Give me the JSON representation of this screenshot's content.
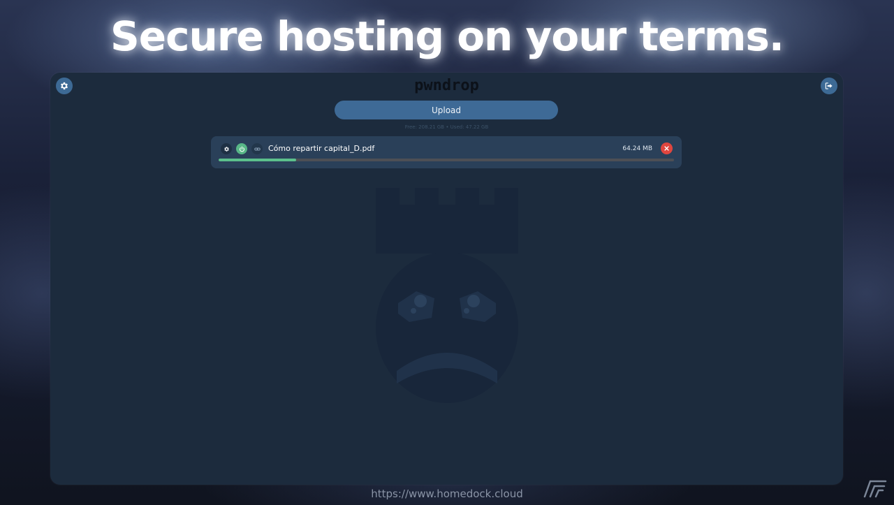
{
  "headline": "Secure hosting on your terms.",
  "app": {
    "logo_text": "pwndrop",
    "upload_label": "Upload",
    "storage_text": "Free: 208.21 GB • Used: 47.22 GB"
  },
  "file": {
    "name": "Cómo repartir capital_D.pdf",
    "size": "64.24 MB",
    "upload_progress_percent": 17
  },
  "icons": {
    "settings": "gear-icon",
    "logout": "logout-icon",
    "file_settings": "gear-icon",
    "file_power": "power-icon",
    "file_link": "link-icon",
    "file_delete": "close-icon",
    "background_mascot": "mascot-castle-bomb-icon",
    "brand_corner": "brand-logo-icon"
  },
  "colors": {
    "panel_bg": "#1c2b3d",
    "accent_blue": "#3e6a96",
    "card_bg": "#2a4059",
    "success_green": "#5cc08c",
    "danger_red": "#e0463f"
  },
  "footer": {
    "url": "https://www.homedock.cloud"
  }
}
